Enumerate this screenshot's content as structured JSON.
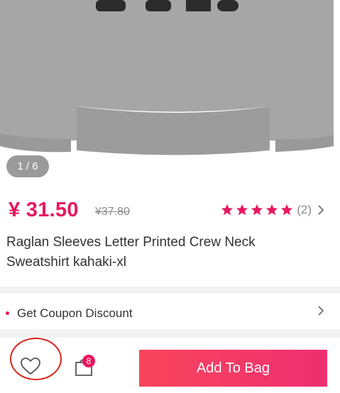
{
  "gallery": {
    "counter": "1 / 6"
  },
  "product": {
    "price": "¥ 31.50",
    "original_price": "¥37.80",
    "rating": 5,
    "review_count": "(2)",
    "title": "Raglan Sleeves Letter Printed Crew Neck Sweatshirt kahaki-xl"
  },
  "coupon": {
    "label": "Get Coupon Discount"
  },
  "bottom_bar": {
    "cart_count": "8",
    "add_to_bag_label": "Add To Bag"
  },
  "colors": {
    "accent": "#e8175d",
    "button_start": "#f9455b",
    "button_end": "#ee2f72",
    "highlight_ring": "#d9241c"
  },
  "icons": [
    "wishlist-heart-icon",
    "shopping-bag-icon",
    "star-icon",
    "chevron-right-icon"
  ]
}
